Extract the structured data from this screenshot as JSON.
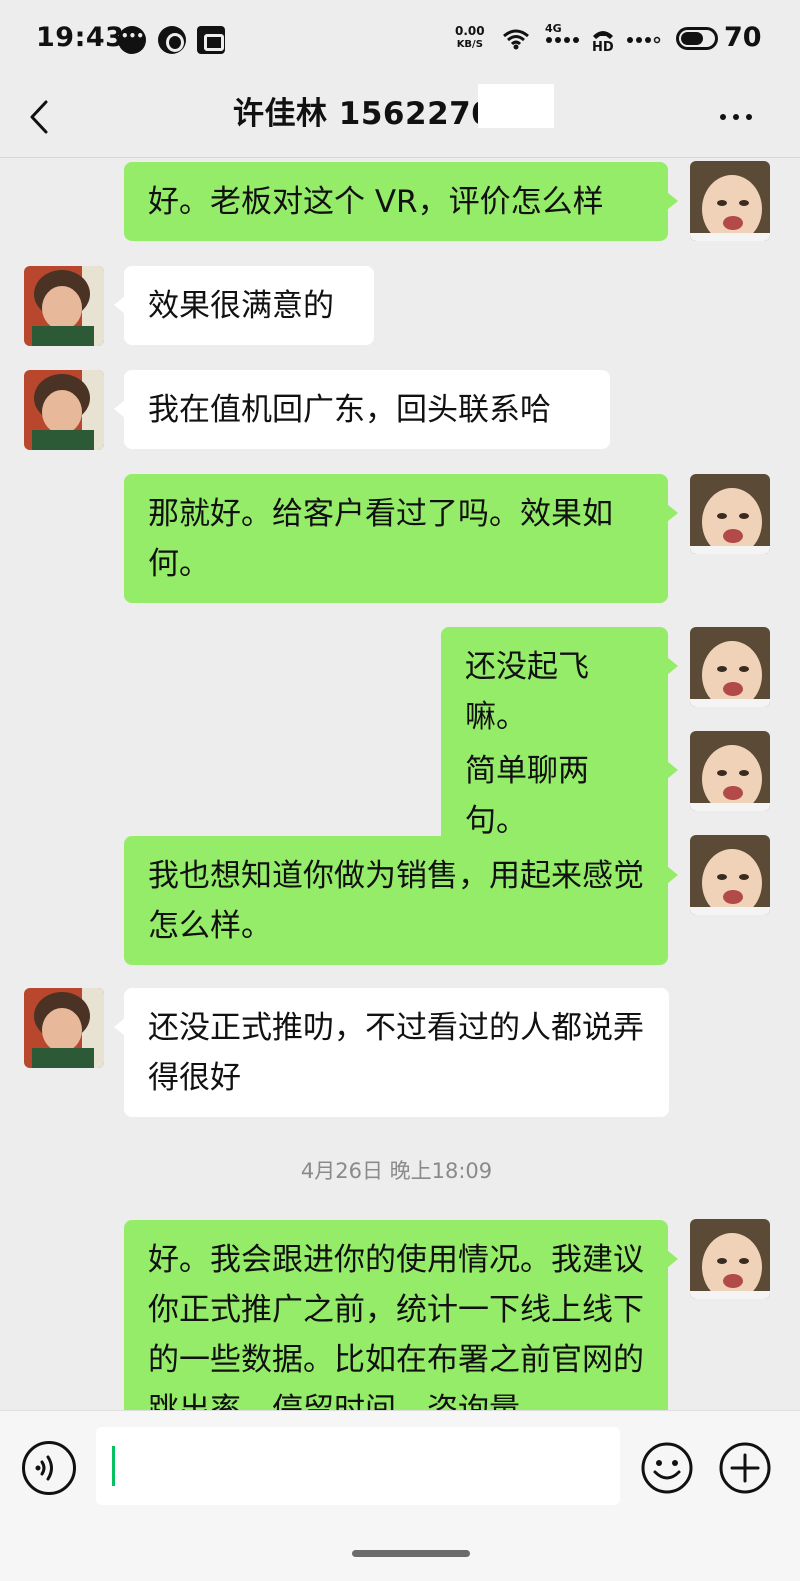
{
  "status_bar": {
    "time": "19:43",
    "notification_icons": [
      "chat-bubble-icon",
      "drop-icon",
      "gift-box-icon"
    ],
    "net_speed_value": "0.00",
    "net_speed_unit": "KB/S",
    "network_label": "4G",
    "hd_label": "HD",
    "battery_level": "70",
    "battery_fraction": 0.7
  },
  "header": {
    "title": "许佳林 1562270",
    "back_icon": "chevron-left-icon",
    "more_icon": "more-dots-icon"
  },
  "messages": [
    {
      "sender": "me",
      "text": "好。老板对这个 VR，评价怎么样"
    },
    {
      "sender": "them",
      "text": "效果很满意的"
    },
    {
      "sender": "them",
      "text": "我在值机回广东，回头联系哈"
    },
    {
      "sender": "me",
      "text": "那就好。给客户看过了吗。效果如何。"
    },
    {
      "sender": "me",
      "text": "还没起飞嘛。"
    },
    {
      "sender": "me",
      "text": "简单聊两句。"
    },
    {
      "sender": "me",
      "text": "我也想知道你做为销售，用起来感觉怎么样。"
    },
    {
      "sender": "them",
      "text": "还没正式推叻，不过看过的人都说弄得很好"
    },
    {
      "sender": "me",
      "text": "好。我会跟进你的使用情况。我建议你正式推广之前，统计一下线上线下的一些数据。比如在布署之前官网的跳出率，停留时间，咨询量"
    }
  ],
  "timestamp": "4月26日 晚上18:09",
  "input_bar": {
    "voice_icon": "voice-icon",
    "emoji_icon": "emoji-icon",
    "plus_icon": "plus-icon",
    "input_value": ""
  },
  "colors": {
    "background": "#ededed",
    "my_bubble": "#95ec69",
    "their_bubble": "#ffffff",
    "caret": "#07c160"
  }
}
